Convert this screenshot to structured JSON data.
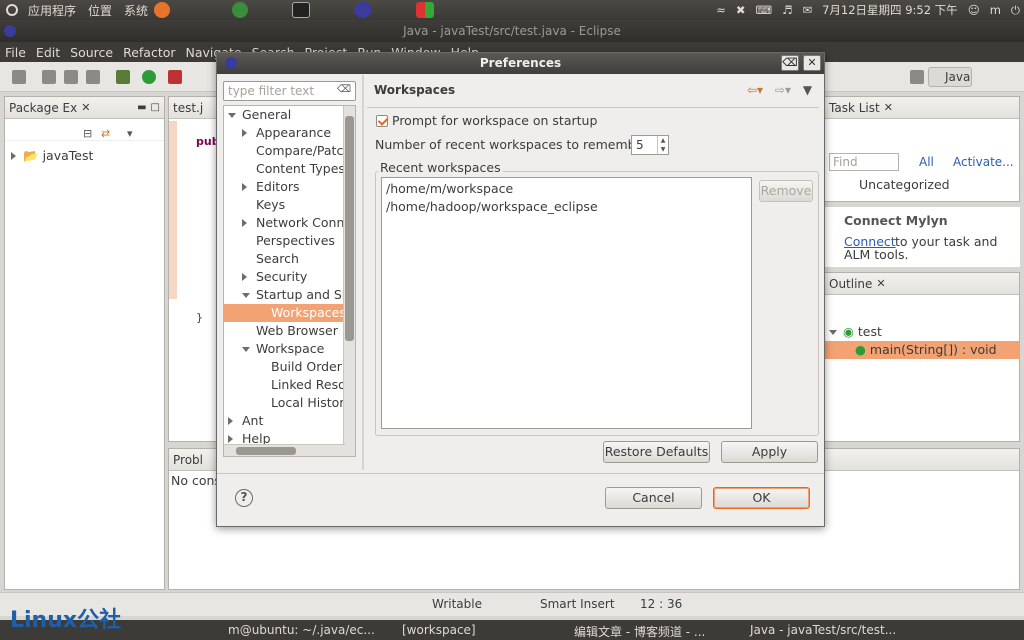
{
  "top_panel": {
    "apps": "应用程序",
    "places": "位置",
    "system": "系统",
    "datetime": "7月12日星期四  9:52 下午",
    "user": "m"
  },
  "window_title": "Java - javaTest/src/test.java - Eclipse",
  "menu": [
    "File",
    "Edit",
    "Source",
    "Refactor",
    "Navigate",
    "Search",
    "Project",
    "Run",
    "Window",
    "Help"
  ],
  "perspective": "Java",
  "package_explorer": {
    "tab": "Package Ex",
    "project": "javaTest"
  },
  "editor": {
    "tab": "test.j",
    "line1": "publ",
    "line2": "}"
  },
  "task_list": {
    "tab": "Task List",
    "find_placeholder": "Find",
    "all": "All",
    "activate": "Activate...",
    "category": "Uncategorized"
  },
  "mylyn": {
    "title": "Connect Mylyn",
    "link": "Connect",
    "text1": "to your task and",
    "text2": "ALM tools."
  },
  "outline": {
    "tab": "Outline",
    "class": "test",
    "method": "main(String[]) : void"
  },
  "problems": {
    "tab": "Probl",
    "text": "No cons"
  },
  "status_bar": {
    "writable": "Writable",
    "insert": "Smart Insert",
    "position": "12 : 36"
  },
  "taskbar": {
    "watermark": "Linux公社",
    "item1": "m@ubuntu: ~/.java/ec...",
    "item2": "[workspace]",
    "item3": "编辑文章 - 博客频道 - ...",
    "item4": "Java - javaTest/src/test..."
  },
  "dialog": {
    "title": "Preferences",
    "filter_placeholder": "type filter text",
    "tree": [
      {
        "label": "General",
        "level": 0,
        "expanded": true
      },
      {
        "label": "Appearance",
        "level": 1,
        "expanded": false
      },
      {
        "label": "Compare/Patch",
        "level": 1,
        "expanded": null
      },
      {
        "label": "Content Types",
        "level": 1,
        "expanded": null
      },
      {
        "label": "Editors",
        "level": 1,
        "expanded": false
      },
      {
        "label": "Keys",
        "level": 1,
        "expanded": null
      },
      {
        "label": "Network Connections",
        "level": 1,
        "expanded": false
      },
      {
        "label": "Perspectives",
        "level": 1,
        "expanded": null
      },
      {
        "label": "Search",
        "level": 1,
        "expanded": null
      },
      {
        "label": "Security",
        "level": 1,
        "expanded": false
      },
      {
        "label": "Startup and Shutdown",
        "level": 1,
        "expanded": true
      },
      {
        "label": "Workspaces",
        "level": 2,
        "expanded": null,
        "selected": true
      },
      {
        "label": "Web Browser",
        "level": 1,
        "expanded": null
      },
      {
        "label": "Workspace",
        "level": 1,
        "expanded": true
      },
      {
        "label": "Build Order",
        "level": 2,
        "expanded": null
      },
      {
        "label": "Linked Resources",
        "level": 2,
        "expanded": null
      },
      {
        "label": "Local History",
        "level": 2,
        "expanded": null
      },
      {
        "label": "Ant",
        "level": 0,
        "expanded": false
      },
      {
        "label": "Help",
        "level": 0,
        "expanded": false
      }
    ],
    "page_heading": "Workspaces",
    "prompt_label": "Prompt for workspace on startup",
    "prompt_checked": true,
    "remember_label": "Number of recent workspaces to remember:",
    "remember_value": "5",
    "recent_group_label": "Recent workspaces",
    "recent": [
      "/home/m/workspace",
      "/home/hadoop/workspace_eclipse"
    ],
    "remove_label": "Remove",
    "restore_label": "Restore Defaults",
    "apply_label": "Apply",
    "cancel_label": "Cancel",
    "ok_label": "OK"
  },
  "colors": {
    "accent": "#e2681d",
    "selection": "#f3a273",
    "panel": "#3c3b37"
  }
}
